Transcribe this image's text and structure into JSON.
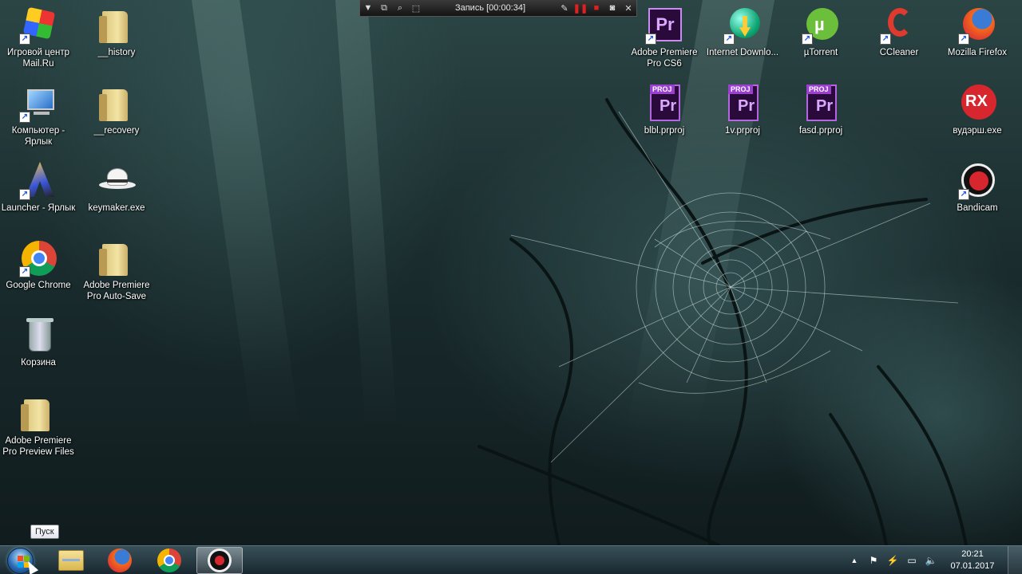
{
  "recording_toolbar": {
    "title": "Запись [00:00:34]",
    "icons": [
      "dropdown-icon",
      "window-icon",
      "zoom-icon",
      "region-icon",
      "pencil-icon",
      "pause-icon",
      "stop-icon",
      "camera-icon",
      "close-icon"
    ]
  },
  "desktop": {
    "icons": [
      {
        "label": "Игровой центр Mail.Ru",
        "icon": "game-center-icon"
      },
      {
        "label": "__history",
        "icon": "folder-icon"
      },
      {
        "label": "Компьютер - Ярлык",
        "icon": "computer-icon"
      },
      {
        "label": "__recovery",
        "icon": "folder-icon"
      },
      {
        "label": "Launcher - Ярлык",
        "icon": "launcher-icon"
      },
      {
        "label": "keymaker.exe",
        "icon": "keymaker-icon"
      },
      {
        "label": "Google Chrome",
        "icon": "chrome-icon"
      },
      {
        "label": "Adobe Premiere Pro Auto-Save",
        "icon": "folder-icon"
      },
      {
        "label": "Корзина",
        "icon": "recycle-bin-icon"
      },
      {
        "label": "Adobe Premiere Pro Preview Files",
        "icon": "folder-icon"
      },
      {
        "label": "Adobe Premiere Pro CS6",
        "icon": "premiere-icon"
      },
      {
        "label": "Internet Downlo...",
        "icon": "idm-icon"
      },
      {
        "label": "µTorrent",
        "icon": "utorrent-icon"
      },
      {
        "label": "CCleaner",
        "icon": "ccleaner-icon"
      },
      {
        "label": "Mozilla Firefox",
        "icon": "firefox-icon"
      },
      {
        "label": "blbl.prproj",
        "icon": "prproj-icon"
      },
      {
        "label": "1v.prproj",
        "icon": "prproj-icon"
      },
      {
        "label": "fasd.prproj",
        "icon": "prproj-icon"
      },
      {
        "label": "вудэрш.exe",
        "icon": "rx-icon"
      },
      {
        "label": "Bandicam",
        "icon": "bandicam-icon"
      }
    ],
    "prproj_tag": "PROJ",
    "premiere_letters": "Pr",
    "rx_letters": "RX"
  },
  "tooltip": {
    "text": "Пуск"
  },
  "taskbar": {
    "pinned": [
      {
        "name": "explorer",
        "icon": "explorer-icon"
      },
      {
        "name": "firefox",
        "icon": "firefox-icon"
      },
      {
        "name": "chrome",
        "icon": "chrome-icon"
      },
      {
        "name": "bandicam",
        "icon": "bandicam-icon",
        "active": true
      }
    ],
    "tray": [
      "show-hidden-icon",
      "action-center-icon",
      "power-icon",
      "network-icon",
      "volume-icon"
    ],
    "clock": {
      "time": "20:21",
      "date": "07.01.2017"
    }
  },
  "colors": {
    "taskbar": "#2a3d46",
    "premiere_purple": "#2a0a3a",
    "record_red": "#e02020"
  }
}
